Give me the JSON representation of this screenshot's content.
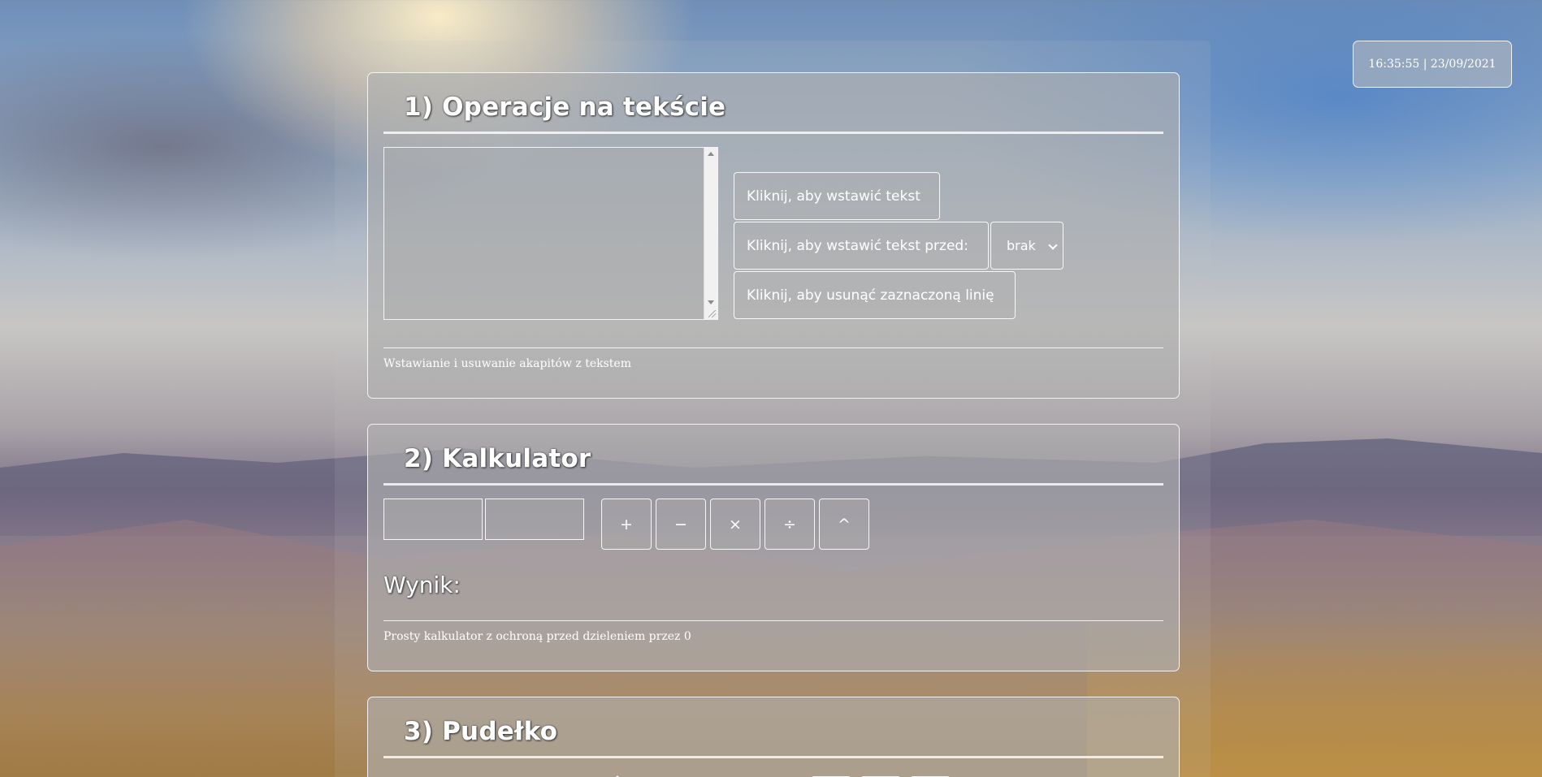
{
  "clock": {
    "text": "16:35:55 | 23/09/2021"
  },
  "section1": {
    "title": "1) Operacje na tekście",
    "textarea_value": "",
    "buttons": {
      "insert": "Kliknij, aby wstawić tekst",
      "insert_before": "Kliknij, aby wstawić tekst przed:",
      "delete": "Kliknij, aby usunąć zaznaczoną linię"
    },
    "select_value": "brak",
    "footer": "Wstawianie i usuwanie akapitów z tekstem"
  },
  "section2": {
    "title": "2) Kalkulator",
    "input_a": "",
    "input_b": "",
    "operators": {
      "add": "+",
      "subtract": "−",
      "multiply": "×",
      "divide": "÷",
      "power": "^"
    },
    "result_label": "Wynik:",
    "result_value": "",
    "footer": "Prosty kalkulator z ochroną przed dzieleniem przez 0"
  },
  "section3": {
    "title": "3) Pudełko"
  }
}
